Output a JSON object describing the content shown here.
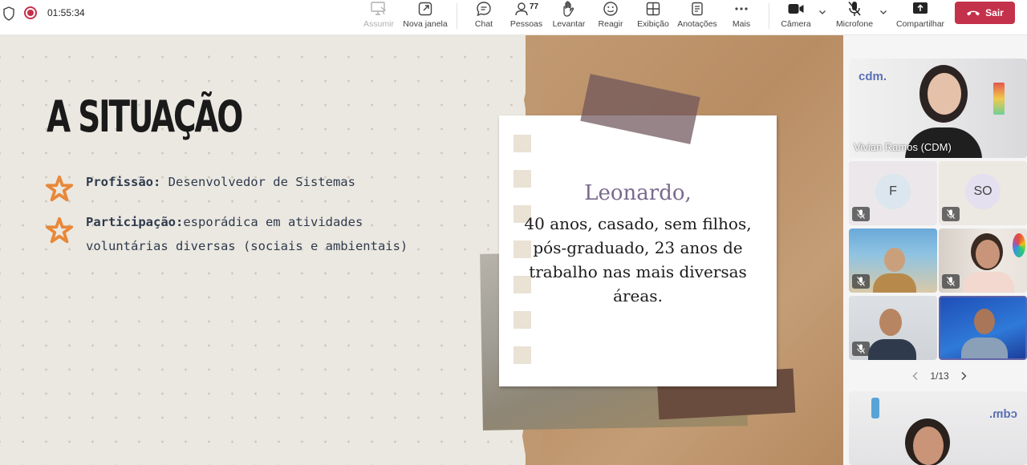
{
  "toolbar": {
    "timer": "01:55:34",
    "buttons": {
      "assumir": "Assumir",
      "nova_janela": "Nova janela",
      "chat": "Chat",
      "pessoas": "Pessoas",
      "pessoas_count": "77",
      "levantar": "Levantar",
      "reagir": "Reagir",
      "exibicao": "Exibição",
      "anotacoes": "Anotações",
      "mais": "Mais",
      "camera": "Câmera",
      "microfone": "Microfone",
      "compartilhar": "Compartilhar",
      "sair": "Sair"
    },
    "colors": {
      "leave": "#c4314b",
      "recording": "#c4314b"
    }
  },
  "slide": {
    "title": "A SITUAÇÃO",
    "bullets": [
      {
        "label": "Profissão:",
        "text": " Desenvolvedor de Sistemas"
      },
      {
        "label": "Participação:",
        "text": "esporádica em atividades voluntárias diversas (sociais e ambientais)"
      }
    ],
    "note": {
      "name": "Leonardo,",
      "text": "40 anos, casado, sem filhos, pós-graduado, 23 anos de trabalho nas mais diversas áreas."
    },
    "colors": {
      "star": "#e8883a",
      "name": "#7a6a8e",
      "body": "#2e3a4d"
    }
  },
  "participants": {
    "featured": {
      "name": "Vivian Ramos (CDM)",
      "logo": "cdm."
    },
    "tiles": [
      {
        "initials": "F",
        "muted": true
      },
      {
        "initials": "SO",
        "muted": true
      },
      {
        "initials": "",
        "muted": true
      },
      {
        "initials": "",
        "muted": true
      },
      {
        "initials": "",
        "muted": true
      },
      {
        "initials": "",
        "muted": false
      }
    ],
    "pager": {
      "text": "1/13"
    },
    "bottom_logo": "cdm."
  }
}
